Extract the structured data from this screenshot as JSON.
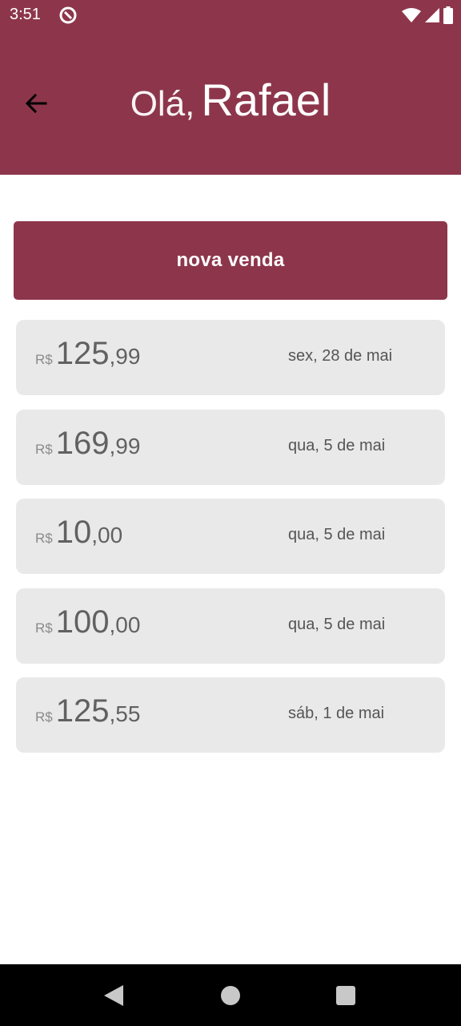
{
  "status_bar": {
    "time": "3:51"
  },
  "header": {
    "greeting_prefix": "Olá,",
    "user_name": "Rafael",
    "background_color": "#8d364b"
  },
  "actions": {
    "new_sale_label": "nova venda"
  },
  "sales": [
    {
      "currency": "R$",
      "integer": "125",
      "decimal": ",99",
      "date": "sex, 28 de mai"
    },
    {
      "currency": "R$",
      "integer": "169",
      "decimal": ",99",
      "date": "qua, 5 de mai"
    },
    {
      "currency": "R$",
      "integer": "10",
      "decimal": ",00",
      "date": "qua, 5 de mai"
    },
    {
      "currency": "R$",
      "integer": "100",
      "decimal": ",00",
      "date": "qua, 5 de mai"
    },
    {
      "currency": "R$",
      "integer": "125",
      "decimal": ",55",
      "date": "sáb, 1 de mai"
    }
  ],
  "icons": {
    "back": "arrow-left-icon",
    "app_status": "app-notification-icon",
    "wifi": "wifi-icon",
    "signal": "cell-signal-icon",
    "battery": "battery-icon"
  }
}
